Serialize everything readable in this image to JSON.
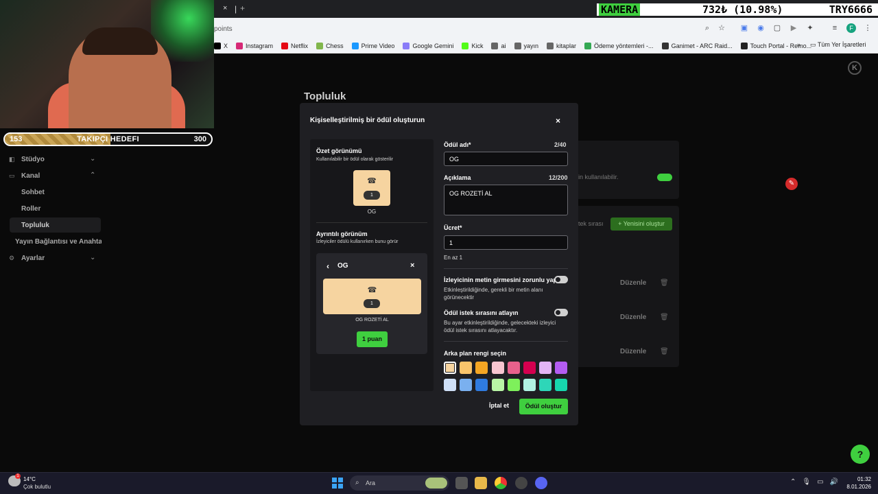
{
  "browser": {
    "tab_close": "×",
    "tab_separator": "|",
    "tab_plus": "+",
    "address": "points",
    "profile_initial": "F",
    "bookmarks": [
      {
        "label": "X",
        "icon": "x-icon",
        "color": "#000000"
      },
      {
        "label": "Instagram",
        "icon": "instagram-icon",
        "color": "#d62976"
      },
      {
        "label": "Netflix",
        "icon": "netflix-icon",
        "color": "#e50914"
      },
      {
        "label": "Chess",
        "icon": "chess-icon",
        "color": "#81b64c"
      },
      {
        "label": "Prime Video",
        "icon": "prime-video-icon",
        "color": "#1a98ff"
      },
      {
        "label": "Google Gemini",
        "icon": "gemini-icon",
        "color": "#8a7cf8"
      },
      {
        "label": "Kick",
        "icon": "kick-icon",
        "color": "#53fc18"
      },
      {
        "label": "ai",
        "icon": "folder-icon",
        "color": "#666666"
      },
      {
        "label": "yayın",
        "icon": "folder-icon",
        "color": "#666666"
      },
      {
        "label": "kitaplar",
        "icon": "folder-icon",
        "color": "#666666"
      },
      {
        "label": "Ödeme yöntemleri -...",
        "icon": "drive-icon",
        "color": "#34a853"
      },
      {
        "label": "Ganimet - ARC Raid...",
        "icon": "ganimet-icon",
        "color": "#333333"
      },
      {
        "label": "Touch Portal - Remo...",
        "icon": "touch-portal-icon",
        "color": "#222222"
      }
    ],
    "bookmarks_more": "»",
    "all_bookmarks": "Tüm Yer İşaretleri"
  },
  "ticker": {
    "symbol": "KAMERA",
    "price": "732₺ (10.98%)",
    "pair": "TRY6666"
  },
  "overlay": {
    "goal_start": "153",
    "goal_label": "TAKIPÇI HEDEFI",
    "goal_end": "300",
    "goal_progress": 0.51
  },
  "sidebar": {
    "items": [
      {
        "label": "Stüdyo",
        "icon": "studio-icon"
      },
      {
        "label": "Kanal",
        "icon": "channel-icon"
      },
      {
        "label": "Sohbet"
      },
      {
        "label": "Roller"
      },
      {
        "label": "Topluluk"
      },
      {
        "label": "Yayın Bağlantısı ve Anahtarı"
      },
      {
        "label": "Ayarlar",
        "icon": "settings-icon"
      }
    ]
  },
  "page": {
    "title": "Topluluk",
    "bg_toggle_text": "in kullanılabilir.",
    "bg_queue_text": "tek sırası",
    "new_button": "Yenisini oluştur",
    "edit_labels": [
      "Düzenle",
      "Düzenle",
      "Düzenle"
    ]
  },
  "modal": {
    "title": "Kişiselleştirilmiş bir ödül oluşturun",
    "close": "×",
    "summary_title": "Özet görünümü",
    "summary_desc": "Kullanılabilir bir ödül olarak gösterilir",
    "summary_count": "1",
    "summary_name": "OG",
    "detail_title": "Ayrıntılı görünüm",
    "detail_desc": "İzleyiciler ödülü kullanırken bunu görür",
    "detail_name": "OG",
    "detail_count": "1",
    "detail_description": "OG ROZETİ AL",
    "detail_cost": "1 puan",
    "name_label": "Ödül adı*",
    "name_count": "2/40",
    "name_value": "OG",
    "desc_label": "Açıklama",
    "desc_count": "12/200",
    "desc_value": "OG ROZETİ AL",
    "cost_label": "Ücret*",
    "cost_value": "1",
    "cost_hint": "En az 1",
    "require_text_label": "İzleyicinin metin girmesini zorunlu yap",
    "require_text_desc": "Etkinleştirildiğinde, gerekli bir metin alanı görünecektir",
    "require_text_on": false,
    "skip_queue_label": "Ödül istek sırasını atlayın",
    "skip_queue_desc": "Bu ayar etkinleştirildiğinde, gelecekteki izleyici ödül istek sırasını atlayacaktır.",
    "skip_queue_on": false,
    "color_label": "Arka plan rengi seçin",
    "colors": [
      "#f6d4a0",
      "#f9c46b",
      "#f5a623",
      "#f7c5d0",
      "#e8618c",
      "#d4004f",
      "#e3b5f5",
      "#b45cf2",
      "#cfe0f7",
      "#7ab0ef",
      "#2f7be0",
      "#b9f5a6",
      "#7ef05b",
      "#b0f2e3",
      "#2ed6b8",
      "#17d6ae"
    ],
    "selected_color": "#f6d4a0",
    "cancel": "İptal et",
    "submit": "Ödül oluştur"
  },
  "taskbar": {
    "temp": "14°C",
    "weather": "Çok bulutlu",
    "weather_badge": "1",
    "search": "Ara",
    "time": "01:32",
    "date": "8.01.2026"
  }
}
